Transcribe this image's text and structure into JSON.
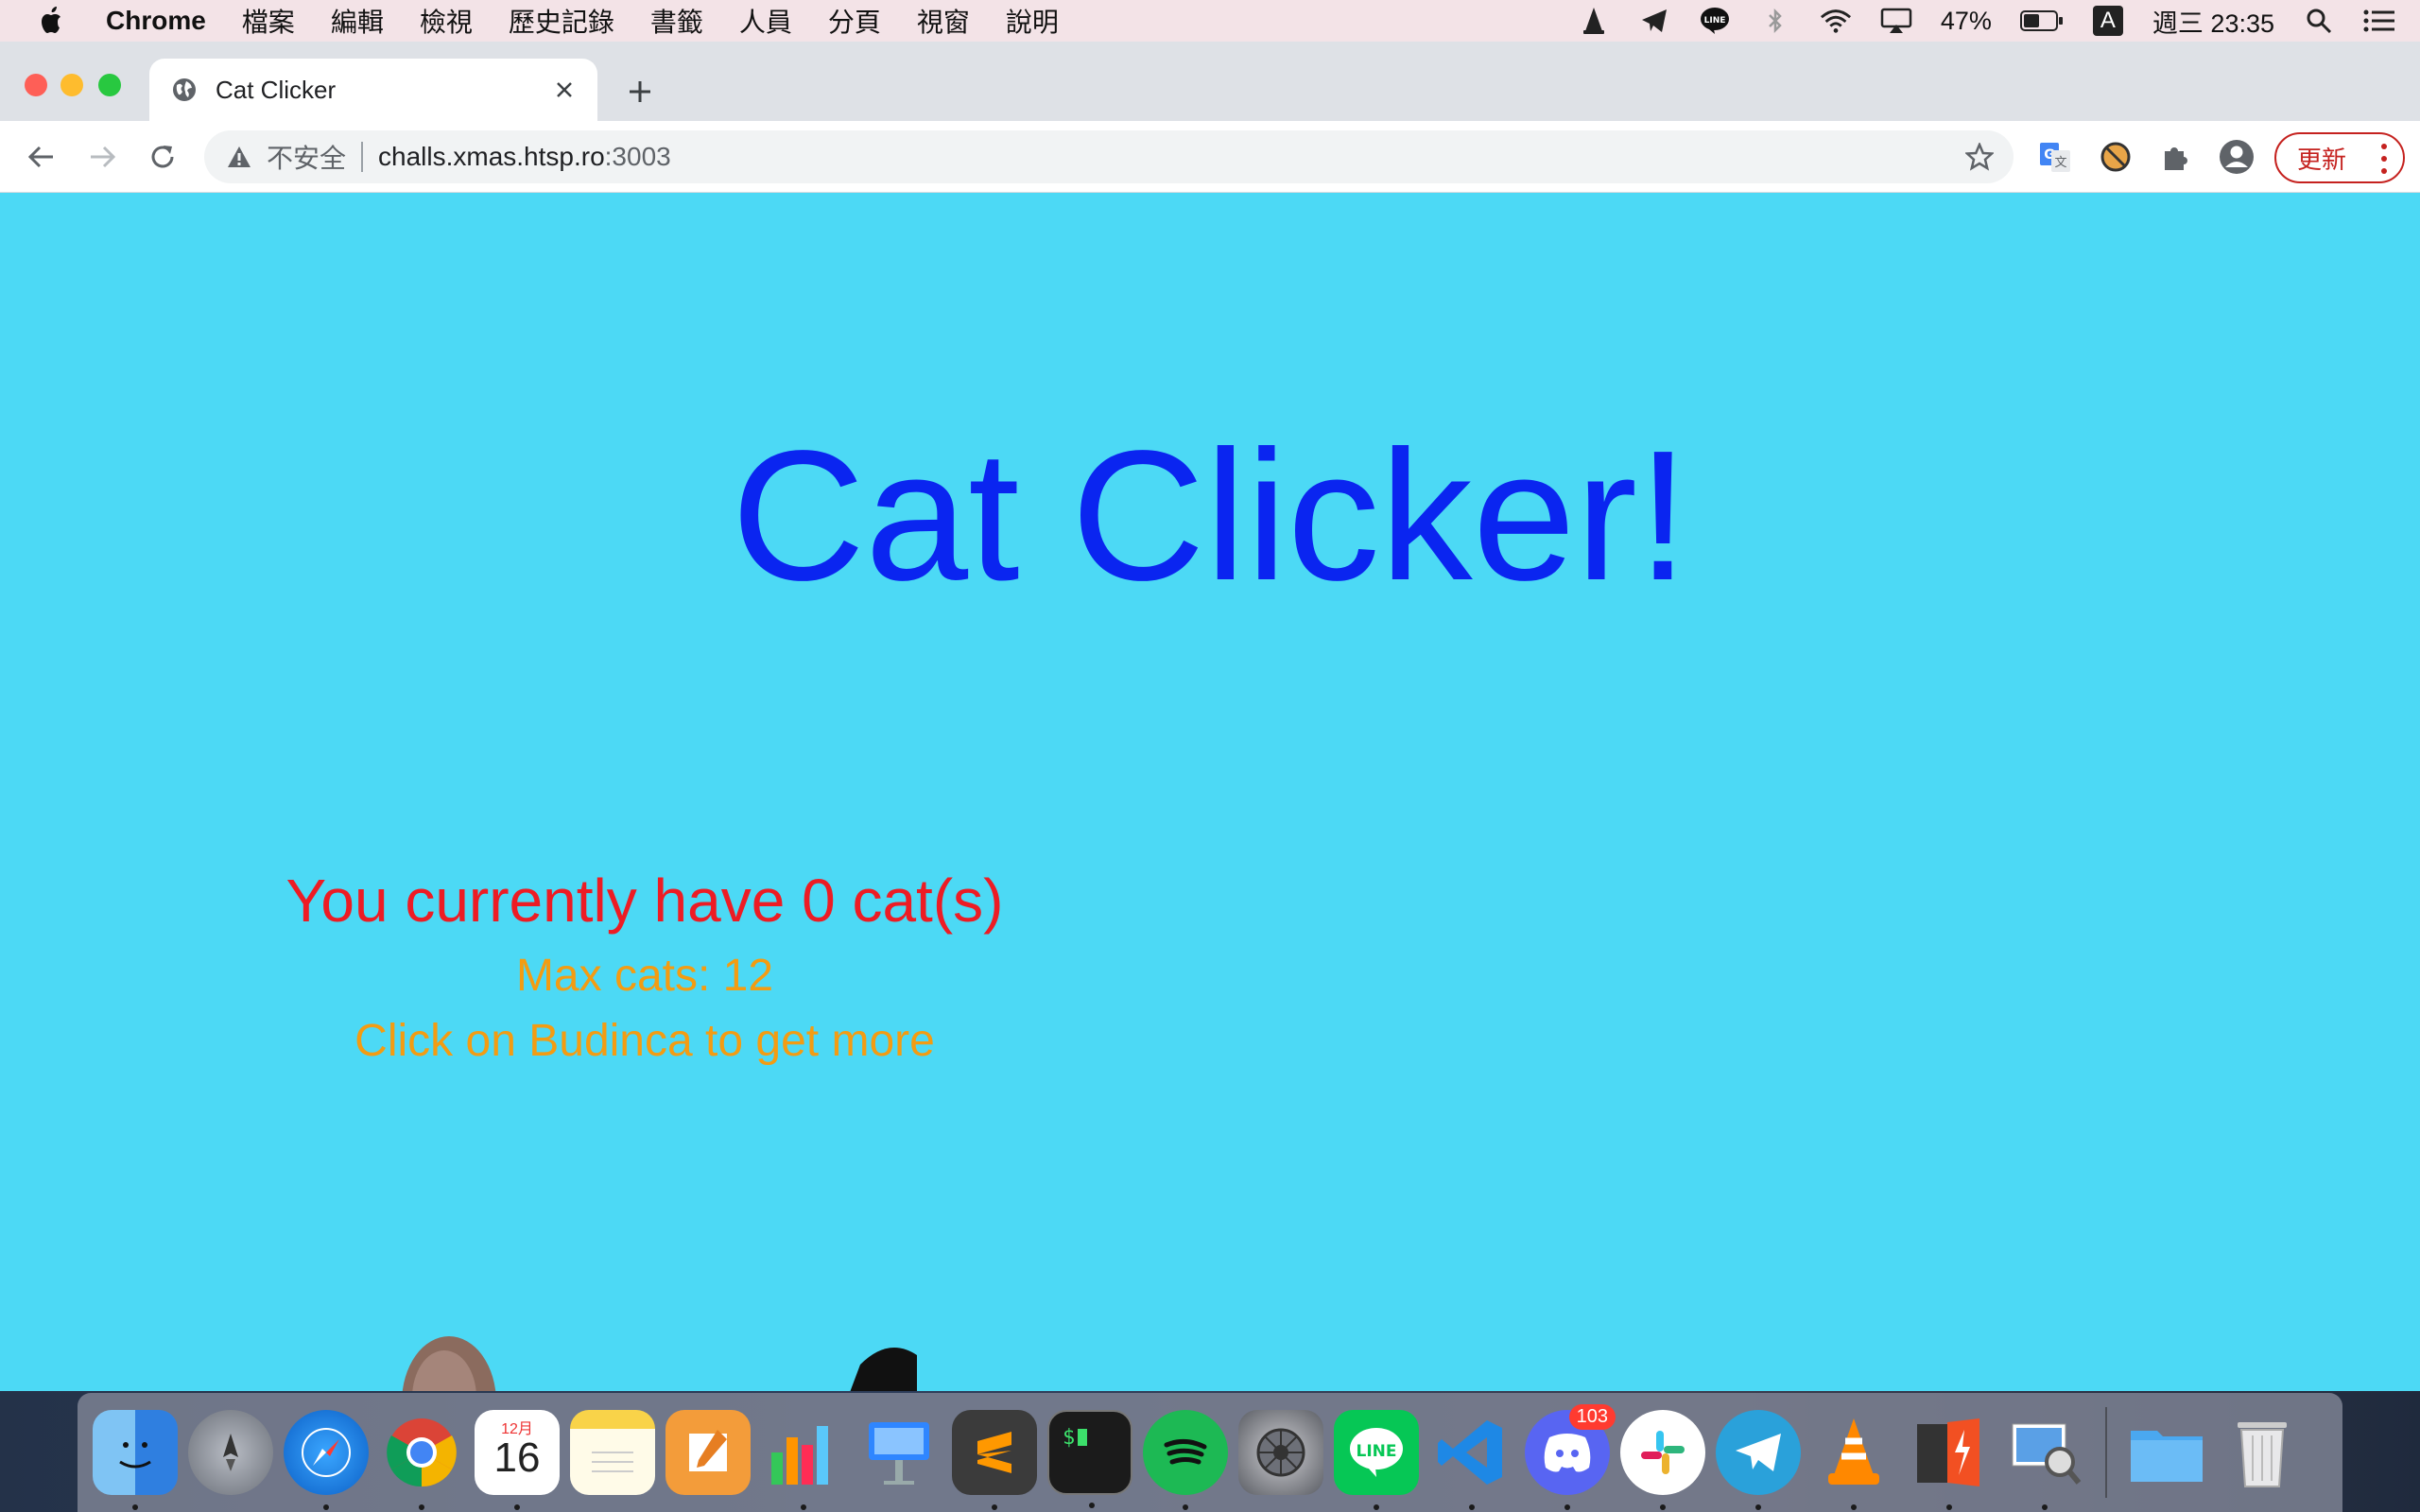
{
  "menubar": {
    "app_name": "Chrome",
    "menus": [
      "檔案",
      "編輯",
      "檢視",
      "歷史記錄",
      "書籤",
      "人員",
      "分頁",
      "視窗",
      "說明"
    ],
    "battery": "47%",
    "input_source": "A",
    "clock": "週三 23:35"
  },
  "browser": {
    "tab_title": "Cat Clicker",
    "security_label": "不安全",
    "url_host": "challs.xmas.htsp.ro",
    "url_port": ":3003",
    "update_label": "更新"
  },
  "page": {
    "heading": "Cat Clicker!",
    "cat_count_text": "You currently have 0 cat(s)",
    "max_cats_text": "Max cats: 12",
    "hint_text": "Click on Budinca to get more"
  },
  "dock": {
    "calendar_month": "12月",
    "calendar_day": "16",
    "line_label": "LINE",
    "discord_badge": "103"
  }
}
